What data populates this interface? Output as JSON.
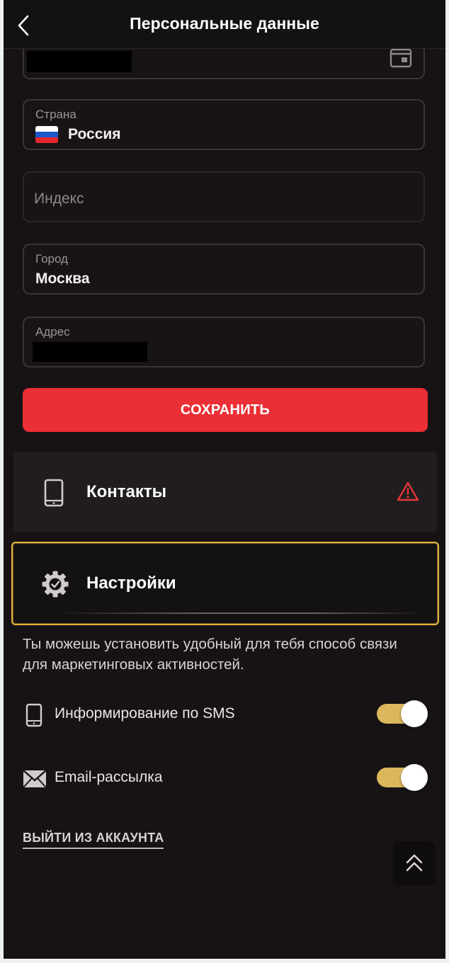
{
  "header": {
    "title": "Персональные данные"
  },
  "form": {
    "country": {
      "label": "Страна",
      "value": "Россия"
    },
    "zip": {
      "placeholder": "Индекс"
    },
    "city": {
      "label": "Город",
      "value": "Москва"
    },
    "address": {
      "label": "Адрес"
    },
    "save_label": "СОХРАНИТЬ"
  },
  "sections": {
    "contacts": {
      "title": "Контакты"
    },
    "settings": {
      "title": "Настройки",
      "description": "Ты можешь установить удобный для тебя способ связи для маркетинговых активностей.",
      "preferences": [
        {
          "label": "Информирование по SMS",
          "enabled": true
        },
        {
          "label": "Email-рассылка",
          "enabled": true
        }
      ]
    }
  },
  "logout_label": "ВЫЙТИ ИЗ АККАУНТА",
  "colors": {
    "accent_red": "#ea3036",
    "toggle_on": "#ddb75c",
    "selected_border": "#e2b53f",
    "warning": "#e2363c"
  },
  "icons": {
    "back": "chevron-left-icon",
    "calendar": "calendar-icon",
    "flag": "russia-flag-icon",
    "contacts": "smartphone-icon",
    "warning": "warning-triangle-icon",
    "settings": "gear-check-icon",
    "sms": "smartphone-icon",
    "email": "envelope-icon",
    "scroll_top": "double-chevron-up-icon"
  }
}
